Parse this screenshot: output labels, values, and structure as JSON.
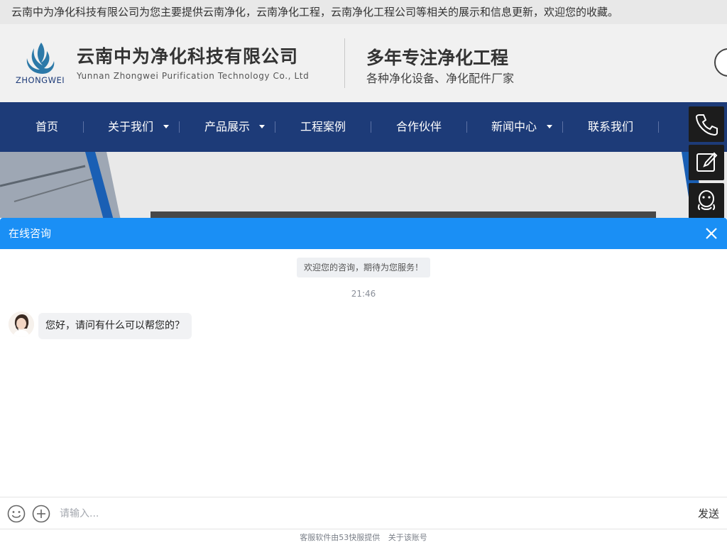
{
  "notice": "云南中为净化科技有限公司为您主要提供云南净化，云南净化工程，云南净化工程公司等相关的展示和信息更新，欢迎您的收藏。",
  "header": {
    "logo_abbr": "ZHONGWEI",
    "company_cn": "云南中为净化科技有限公司",
    "company_en": "Yunnan Zhongwei Purification Technology Co., Ltd",
    "slogan": "多年专注净化工程",
    "slogan_sub": "各种净化设备、净化配件厂家"
  },
  "nav": {
    "items": [
      {
        "label": "首页",
        "has_dropdown": false
      },
      {
        "label": "关于我们",
        "has_dropdown": true
      },
      {
        "label": "产品展示",
        "has_dropdown": true
      },
      {
        "label": "工程案例",
        "has_dropdown": false
      },
      {
        "label": "合作伙伴",
        "has_dropdown": false
      },
      {
        "label": "新闻中心",
        "has_dropdown": true
      },
      {
        "label": "联系我们",
        "has_dropdown": false
      }
    ]
  },
  "float_bar": {
    "icons": [
      "phone-icon",
      "edit-icon",
      "qq-icon"
    ]
  },
  "chat": {
    "title": "在线咨询",
    "welcome": "欢迎您的咨询，期待为您服务！",
    "time": "21:46",
    "agent_message": "您好，请问有什么可以帮您的？",
    "input_placeholder": "请输入...",
    "send_label": "发送",
    "footer_provider": "客服软件由53快服提供",
    "footer_about": "关于该账号"
  },
  "colors": {
    "nav_bg": "#1d3b78",
    "chat_header": "#1a8ff5",
    "float_bg": "#1c1c1c"
  }
}
